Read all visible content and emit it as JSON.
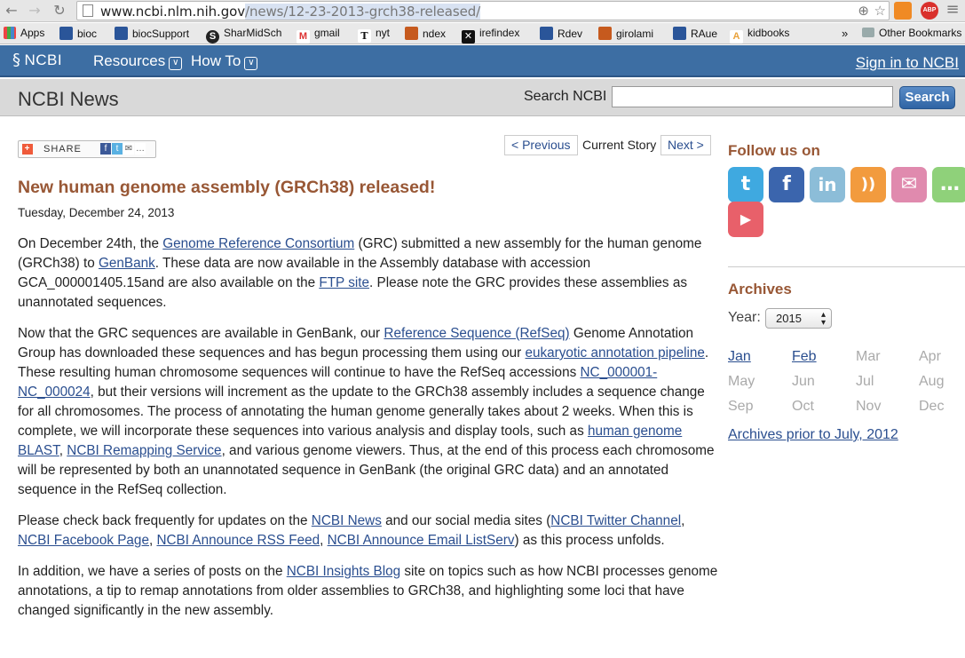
{
  "browser": {
    "url_host": "www.ncbi.nlm.nih.gov",
    "url_path": "/news/12-23-2013-grch38-released/",
    "bookmarks": [
      {
        "label": "Apps"
      },
      {
        "label": "bioc"
      },
      {
        "label": "biocSupport"
      },
      {
        "label": "SharMidSch"
      },
      {
        "label": "gmail"
      },
      {
        "label": "nyt"
      },
      {
        "label": "ndex"
      },
      {
        "label": "irefindex"
      },
      {
        "label": "Rdev"
      },
      {
        "label": "girolami"
      },
      {
        "label": "RAue"
      },
      {
        "label": "kidbooks"
      }
    ],
    "overflow": "»",
    "other_bookmarks": "Other Bookmarks",
    "abp_label": "ABP"
  },
  "header": {
    "logo": "NCBI",
    "nav": [
      "Resources",
      "How To"
    ],
    "signin": "Sign in to NCBI"
  },
  "subheader": {
    "title": "NCBI News",
    "search_label": "Search NCBI",
    "search_value": "",
    "search_button": "Search"
  },
  "share": {
    "label": "SHARE"
  },
  "pager": {
    "previous": "< Previous",
    "current": "Current Story",
    "next": "Next >"
  },
  "article": {
    "title": "New human genome assembly (GRCh38) released!",
    "date": "Tuesday, December 24, 2013",
    "p1": {
      "t1": "On December 24th, the ",
      "l1": "Genome Reference Consortium",
      "t2": " (GRC) submitted a new assembly for the human genome (GRCh38) to ",
      "l2": "GenBank",
      "t3": ".  These data are now available in the Assembly database with accession GCA_000001405.15and are also available on the ",
      "l3": "FTP site",
      "t4": ".  Please note the GRC provides these assemblies as unannotated sequences."
    },
    "p2": {
      "t1": "Now that the GRC sequences are available in GenBank, our ",
      "l1": "Reference Sequence (RefSeq)",
      "t2": " Genome Annotation Group has downloaded these sequences and has begun processing them using our ",
      "l2": "eukaryotic annotation pipeline",
      "t3": ". These resulting human chromosome sequences will continue to have the RefSeq accessions ",
      "l3": "NC_000001-NC_000024",
      "t4": ", but their versions will increment as the update to the GRCh38 assembly includes a sequence change for all chromosomes. The process of annotating the human genome generally takes about 2 weeks.  When this is complete, we will incorporate these sequences into various analysis and display tools, such as ",
      "l4": "human genome BLAST",
      "t5": ", ",
      "l5": "NCBI Remapping Service",
      "t6": ", and various genome viewers.  Thus, at the end of this process each chromosome will be represented by both an unannotated sequence in GenBank (the original GRC data) and an annotated sequence in the RefSeq collection."
    },
    "p3": {
      "t1": "Please check back frequently for updates on the ",
      "l1": "NCBI News",
      "t2": " and our social media sites (",
      "l2": "NCBI Twitter Channel",
      "t3": ", ",
      "l3": "NCBI Facebook Page",
      "t4": ", ",
      "l4": "NCBI Announce RSS Feed",
      "t5": ", ",
      "l5": "NCBI Announce Email ListServ",
      "t6": ") as this process unfolds."
    },
    "p4": {
      "t1": "In addition, we have a series of posts on the ",
      "l1": "NCBI Insights Blog",
      "t2": " site on topics such as how NCBI processes genome annotations, a tip to remap annotations from older assemblies to GRCh38, and highlighting some loci that have changed significantly in the new assembly."
    }
  },
  "sidebar": {
    "follow_heading": "Follow us on",
    "social": [
      {
        "name": "twitter",
        "glyph": "t",
        "color": "#3fa9e0"
      },
      {
        "name": "facebook",
        "glyph": "f",
        "color": "#3b65ad"
      },
      {
        "name": "linkedin",
        "glyph": "in",
        "color": "#8cbdd8"
      },
      {
        "name": "rss",
        "glyph": "))",
        "color": "#f29b3e"
      },
      {
        "name": "email",
        "glyph": "✉",
        "color": "#e08aae"
      },
      {
        "name": "chat",
        "glyph": "…",
        "color": "#8fd17a"
      },
      {
        "name": "youtube",
        "glyph": "▶",
        "color": "#e8606a"
      }
    ],
    "archives_heading": "Archives",
    "year_label": "Year:",
    "year_value": "2015",
    "months": [
      {
        "label": "Jan",
        "link": true
      },
      {
        "label": "Feb",
        "link": true
      },
      {
        "label": "Mar",
        "link": false
      },
      {
        "label": "Apr",
        "link": false
      },
      {
        "label": "May",
        "link": false
      },
      {
        "label": "Jun",
        "link": false
      },
      {
        "label": "Jul",
        "link": false
      },
      {
        "label": "Aug",
        "link": false
      },
      {
        "label": "Sep",
        "link": false
      },
      {
        "label": "Oct",
        "link": false
      },
      {
        "label": "Nov",
        "link": false
      },
      {
        "label": "Dec",
        "link": false
      }
    ],
    "archives_prior": "Archives prior to July, 2012"
  }
}
